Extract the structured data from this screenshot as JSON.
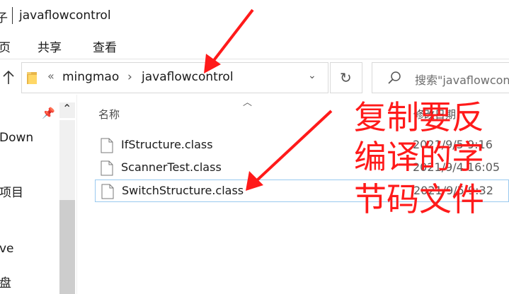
{
  "window": {
    "title_glyph": "子",
    "title": "javaflowcontrol"
  },
  "ribbon": {
    "tabs": [
      "页",
      "共享",
      "查看"
    ]
  },
  "address": {
    "overflow": "«",
    "crumbs": [
      "mingmao",
      "javaflowcontrol"
    ],
    "chevron": "›",
    "dropdown": "⌄",
    "refresh": "↻"
  },
  "search": {
    "placeholder": "搜索\"javaflowcontrol\""
  },
  "nav": {
    "items": [
      "Down",
      "项目",
      "ve",
      "盘"
    ]
  },
  "columns": {
    "name": "名称",
    "date": "修改日期"
  },
  "files": [
    {
      "name": "IfStructure.class",
      "date": "2021/9/5 9:16"
    },
    {
      "name": "ScannerTest.class",
      "date": "2021/9/4 16:05"
    },
    {
      "name": "SwitchStructure.class",
      "date": "2021/9/5 9:32",
      "selected": true
    }
  ],
  "annotation": {
    "lines": [
      "复制要反",
      "编译的字",
      "节码文件"
    ],
    "color": "#ff1a1a"
  }
}
